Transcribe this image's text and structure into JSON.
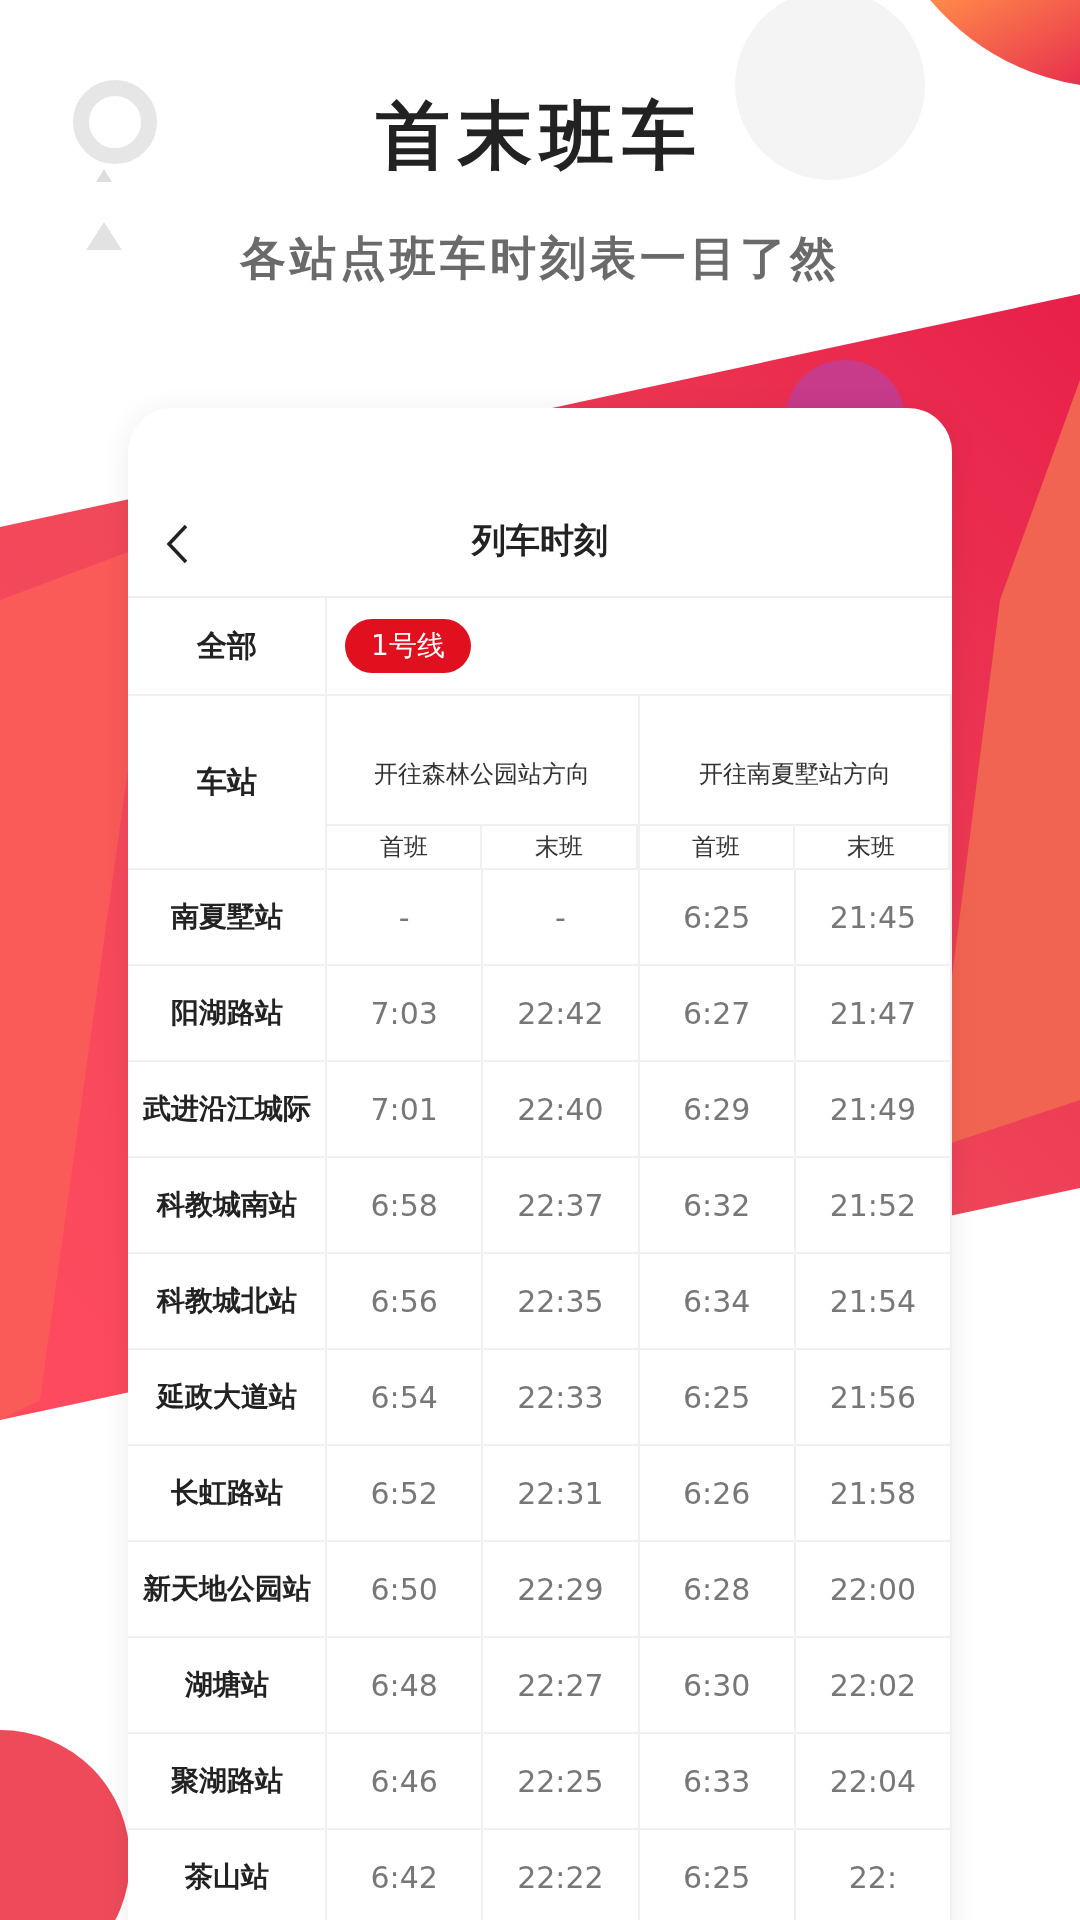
{
  "banner": {
    "title": "首末班车",
    "subtitle": "各站点班车时刻表一目了然"
  },
  "screen": {
    "title": "列车时刻"
  },
  "filters": [
    {
      "label": "全部",
      "selected": false
    },
    {
      "label": "1号线",
      "selected": true
    }
  ],
  "table": {
    "station_header": "车站",
    "directions": [
      {
        "label": "开往森林公园站方向",
        "columns": [
          "首班",
          "末班"
        ]
      },
      {
        "label": "开往南夏墅站方向",
        "columns": [
          "首班",
          "末班"
        ]
      }
    ],
    "rows": [
      {
        "station": "南夏墅站",
        "times": [
          "-",
          "-",
          "6:25",
          "21:45"
        ]
      },
      {
        "station": "阳湖路站",
        "times": [
          "7:03",
          "22:42",
          "6:27",
          "21:47"
        ]
      },
      {
        "station": "武进沿江城际",
        "times": [
          "7:01",
          "22:40",
          "6:29",
          "21:49"
        ]
      },
      {
        "station": "科教城南站",
        "times": [
          "6:58",
          "22:37",
          "6:32",
          "21:52"
        ]
      },
      {
        "station": "科教城北站",
        "times": [
          "6:56",
          "22:35",
          "6:34",
          "21:54"
        ]
      },
      {
        "station": "延政大道站",
        "times": [
          "6:54",
          "22:33",
          "6:25",
          "21:56"
        ]
      },
      {
        "station": "长虹路站",
        "times": [
          "6:52",
          "22:31",
          "6:26",
          "21:58"
        ]
      },
      {
        "station": "新天地公园站",
        "times": [
          "6:50",
          "22:29",
          "6:28",
          "22:00"
        ]
      },
      {
        "station": "湖塘站",
        "times": [
          "6:48",
          "22:27",
          "6:30",
          "22:02"
        ]
      },
      {
        "station": "聚湖路站",
        "times": [
          "6:46",
          "22:25",
          "6:33",
          "22:04"
        ]
      },
      {
        "station": "茶山站",
        "times": [
          "6:42",
          "22:22",
          "6:25",
          "22:"
        ]
      }
    ]
  }
}
